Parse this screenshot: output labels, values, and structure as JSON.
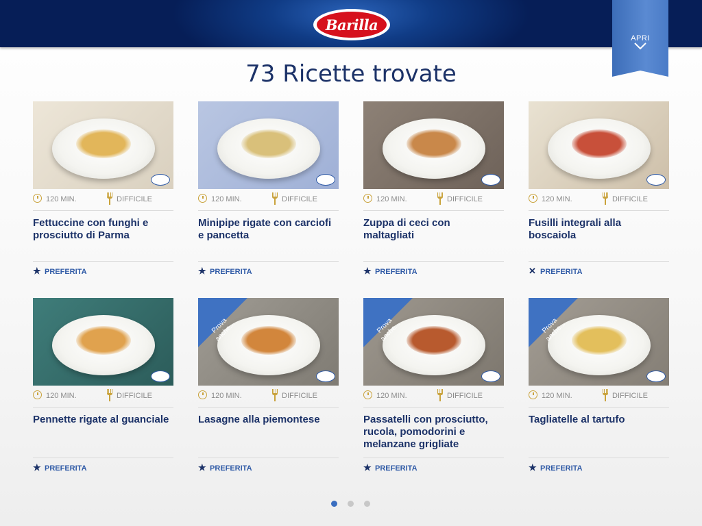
{
  "header": {
    "logo_text": "Barilla",
    "menu_label": "APRI"
  },
  "page": {
    "title": "73 Ricette trovate"
  },
  "recipes": [
    {
      "title": "Fettuccine con funghi e prosciutto di Parma",
      "time": "120 MIN.",
      "difficulty": "DIFFICILE",
      "fav_label": "PREFERITA",
      "fav_icon": "star",
      "prova": ""
    },
    {
      "title": "Minipipe rigate con carciofi e pancetta",
      "time": "120 MIN.",
      "difficulty": "DIFFICILE",
      "fav_label": "PREFERITA",
      "fav_icon": "star",
      "prova": ""
    },
    {
      "title": "Zuppa di ceci con maltagliati",
      "time": "120 MIN.",
      "difficulty": "DIFFICILE",
      "fav_label": "PREFERITA",
      "fav_icon": "star",
      "prova": ""
    },
    {
      "title": "Fusilli integrali alla boscaiola",
      "time": "120 MIN.",
      "difficulty": "DIFFICILE",
      "fav_label": "PREFERITA",
      "fav_icon": "close",
      "prova": ""
    },
    {
      "title": "Pennette rigate al guanciale",
      "time": "120 MIN.",
      "difficulty": "DIFFICILE",
      "fav_label": "PREFERITA",
      "fav_icon": "star",
      "prova": ""
    },
    {
      "title": "Lasagne alla piemontese",
      "time": "120 MIN.",
      "difficulty": "DIFFICILE",
      "fav_label": "PREFERITA",
      "fav_icon": "star",
      "prova": "Prova anche..."
    },
    {
      "title": "Passatelli con prosciutto, rucola, pomodorini e melanzane grigliate",
      "time": "120 MIN.",
      "difficulty": "DIFFICILE",
      "fav_label": "PREFERITA",
      "fav_icon": "star",
      "prova": "Prova anche..."
    },
    {
      "title": "Tagliatelle al tartufo",
      "time": "120 MIN.",
      "difficulty": "DIFFICILE",
      "fav_label": "PREFERITA",
      "fav_icon": "star",
      "prova": "Prova anche..."
    }
  ],
  "pagination": {
    "total": 3,
    "current": 1
  },
  "colors": {
    "accent": "#2f5aa6",
    "title": "#1c3268",
    "gold": "#c9a23b",
    "active_dot": "#3a6ec0"
  }
}
